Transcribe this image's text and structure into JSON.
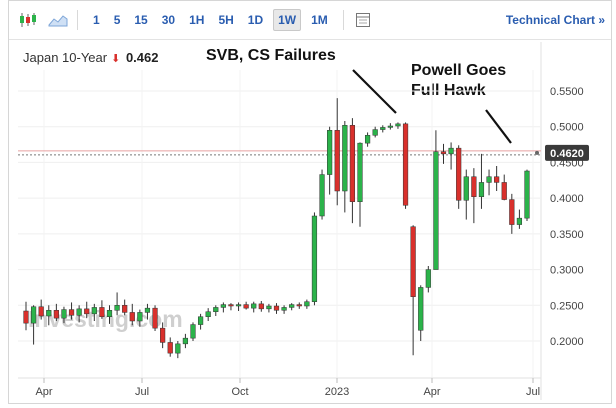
{
  "toolbar": {
    "timeframes": [
      "1",
      "5",
      "15",
      "30",
      "1H",
      "5H",
      "1D",
      "1W",
      "1M"
    ],
    "active_timeframe": "1W",
    "technical_chart_label": "Technical Chart »"
  },
  "instrument": {
    "name": "Japan 10-Year",
    "direction": "down",
    "value": "0.462"
  },
  "annotations": [
    {
      "text": "SVB, CS Failures"
    },
    {
      "text": "Powell Goes\nFull Hawk"
    }
  ],
  "watermark": "Investing.com",
  "price_tag": "0.4620",
  "colors": {
    "up": "#2bb34a",
    "down": "#d9302c",
    "link": "#2a5db0",
    "price_tag_bg": "#3a3a3a"
  },
  "chart_data": {
    "type": "candlestick",
    "x_tick_labels": [
      "Apr",
      "Jul",
      "Oct",
      "2023",
      "Apr",
      "Jul"
    ],
    "y_tick_labels": [
      "0.5500",
      "0.5000",
      "0.4500",
      "0.4000",
      "0.3500",
      "0.3000",
      "0.2500",
      "0.2000"
    ],
    "ylim": [
      0.17,
      0.57
    ],
    "reference_line": 0.462,
    "candles": [
      {
        "o": 0.242,
        "h": 0.255,
        "l": 0.215,
        "c": 0.225
      },
      {
        "o": 0.225,
        "h": 0.25,
        "l": 0.195,
        "c": 0.248
      },
      {
        "o": 0.248,
        "h": 0.258,
        "l": 0.23,
        "c": 0.235
      },
      {
        "o": 0.235,
        "h": 0.25,
        "l": 0.222,
        "c": 0.243
      },
      {
        "o": 0.243,
        "h": 0.252,
        "l": 0.228,
        "c": 0.232
      },
      {
        "o": 0.232,
        "h": 0.248,
        "l": 0.225,
        "c": 0.244
      },
      {
        "o": 0.244,
        "h": 0.254,
        "l": 0.23,
        "c": 0.236
      },
      {
        "o": 0.236,
        "h": 0.25,
        "l": 0.226,
        "c": 0.245
      },
      {
        "o": 0.245,
        "h": 0.255,
        "l": 0.232,
        "c": 0.238
      },
      {
        "o": 0.238,
        "h": 0.252,
        "l": 0.228,
        "c": 0.247
      },
      {
        "o": 0.247,
        "h": 0.257,
        "l": 0.231,
        "c": 0.234
      },
      {
        "o": 0.234,
        "h": 0.25,
        "l": 0.224,
        "c": 0.243
      },
      {
        "o": 0.243,
        "h": 0.268,
        "l": 0.236,
        "c": 0.25
      },
      {
        "o": 0.25,
        "h": 0.258,
        "l": 0.236,
        "c": 0.24
      },
      {
        "o": 0.24,
        "h": 0.252,
        "l": 0.222,
        "c": 0.228
      },
      {
        "o": 0.228,
        "h": 0.244,
        "l": 0.22,
        "c": 0.24
      },
      {
        "o": 0.24,
        "h": 0.252,
        "l": 0.23,
        "c": 0.246
      },
      {
        "o": 0.246,
        "h": 0.25,
        "l": 0.214,
        "c": 0.218
      },
      {
        "o": 0.218,
        "h": 0.226,
        "l": 0.19,
        "c": 0.198
      },
      {
        "o": 0.198,
        "h": 0.205,
        "l": 0.178,
        "c": 0.183
      },
      {
        "o": 0.183,
        "h": 0.2,
        "l": 0.176,
        "c": 0.196
      },
      {
        "o": 0.196,
        "h": 0.21,
        "l": 0.19,
        "c": 0.204
      },
      {
        "o": 0.204,
        "h": 0.226,
        "l": 0.2,
        "c": 0.223
      },
      {
        "o": 0.223,
        "h": 0.238,
        "l": 0.216,
        "c": 0.234
      },
      {
        "o": 0.234,
        "h": 0.246,
        "l": 0.228,
        "c": 0.241
      },
      {
        "o": 0.241,
        "h": 0.25,
        "l": 0.235,
        "c": 0.247
      },
      {
        "o": 0.247,
        "h": 0.254,
        "l": 0.24,
        "c": 0.251
      },
      {
        "o": 0.251,
        "h": 0.253,
        "l": 0.243,
        "c": 0.249
      },
      {
        "o": 0.249,
        "h": 0.254,
        "l": 0.242,
        "c": 0.251
      },
      {
        "o": 0.251,
        "h": 0.255,
        "l": 0.244,
        "c": 0.246
      },
      {
        "o": 0.246,
        "h": 0.255,
        "l": 0.24,
        "c": 0.252
      },
      {
        "o": 0.252,
        "h": 0.256,
        "l": 0.241,
        "c": 0.245
      },
      {
        "o": 0.245,
        "h": 0.252,
        "l": 0.24,
        "c": 0.249
      },
      {
        "o": 0.249,
        "h": 0.253,
        "l": 0.238,
        "c": 0.243
      },
      {
        "o": 0.243,
        "h": 0.25,
        "l": 0.238,
        "c": 0.247
      },
      {
        "o": 0.247,
        "h": 0.253,
        "l": 0.243,
        "c": 0.251
      },
      {
        "o": 0.251,
        "h": 0.254,
        "l": 0.245,
        "c": 0.249
      },
      {
        "o": 0.249,
        "h": 0.258,
        "l": 0.245,
        "c": 0.255
      },
      {
        "o": 0.255,
        "h": 0.38,
        "l": 0.25,
        "c": 0.375
      },
      {
        "o": 0.375,
        "h": 0.44,
        "l": 0.37,
        "c": 0.433
      },
      {
        "o": 0.433,
        "h": 0.5,
        "l": 0.405,
        "c": 0.495
      },
      {
        "o": 0.495,
        "h": 0.54,
        "l": 0.39,
        "c": 0.41
      },
      {
        "o": 0.41,
        "h": 0.508,
        "l": 0.38,
        "c": 0.502
      },
      {
        "o": 0.502,
        "h": 0.512,
        "l": 0.365,
        "c": 0.395
      },
      {
        "o": 0.395,
        "h": 0.478,
        "l": 0.36,
        "c": 0.477
      },
      {
        "o": 0.477,
        "h": 0.492,
        "l": 0.472,
        "c": 0.488
      },
      {
        "o": 0.488,
        "h": 0.5,
        "l": 0.485,
        "c": 0.496
      },
      {
        "o": 0.496,
        "h": 0.502,
        "l": 0.492,
        "c": 0.499
      },
      {
        "o": 0.499,
        "h": 0.505,
        "l": 0.496,
        "c": 0.501
      },
      {
        "o": 0.501,
        "h": 0.506,
        "l": 0.497,
        "c": 0.504
      },
      {
        "o": 0.504,
        "h": 0.506,
        "l": 0.385,
        "c": 0.39
      },
      {
        "o": 0.36,
        "h": 0.362,
        "l": 0.18,
        "c": 0.262
      },
      {
        "o": 0.215,
        "h": 0.278,
        "l": 0.2,
        "c": 0.275
      },
      {
        "o": 0.275,
        "h": 0.305,
        "l": 0.268,
        "c": 0.3
      },
      {
        "o": 0.3,
        "h": 0.495,
        "l": 0.345,
        "c": 0.465
      },
      {
        "o": 0.465,
        "h": 0.476,
        "l": 0.448,
        "c": 0.462
      },
      {
        "o": 0.462,
        "h": 0.478,
        "l": 0.44,
        "c": 0.47
      },
      {
        "o": 0.47,
        "h": 0.474,
        "l": 0.385,
        "c": 0.397
      },
      {
        "o": 0.397,
        "h": 0.44,
        "l": 0.37,
        "c": 0.43
      },
      {
        "o": 0.43,
        "h": 0.442,
        "l": 0.365,
        "c": 0.402
      },
      {
        "o": 0.402,
        "h": 0.462,
        "l": 0.385,
        "c": 0.422
      },
      {
        "o": 0.422,
        "h": 0.44,
        "l": 0.404,
        "c": 0.43
      },
      {
        "o": 0.43,
        "h": 0.445,
        "l": 0.41,
        "c": 0.422
      },
      {
        "o": 0.422,
        "h": 0.433,
        "l": 0.397,
        "c": 0.398
      },
      {
        "o": 0.398,
        "h": 0.406,
        "l": 0.35,
        "c": 0.363
      },
      {
        "o": 0.363,
        "h": 0.384,
        "l": 0.357,
        "c": 0.372
      },
      {
        "o": 0.372,
        "h": 0.44,
        "l": 0.368,
        "c": 0.438
      }
    ]
  }
}
